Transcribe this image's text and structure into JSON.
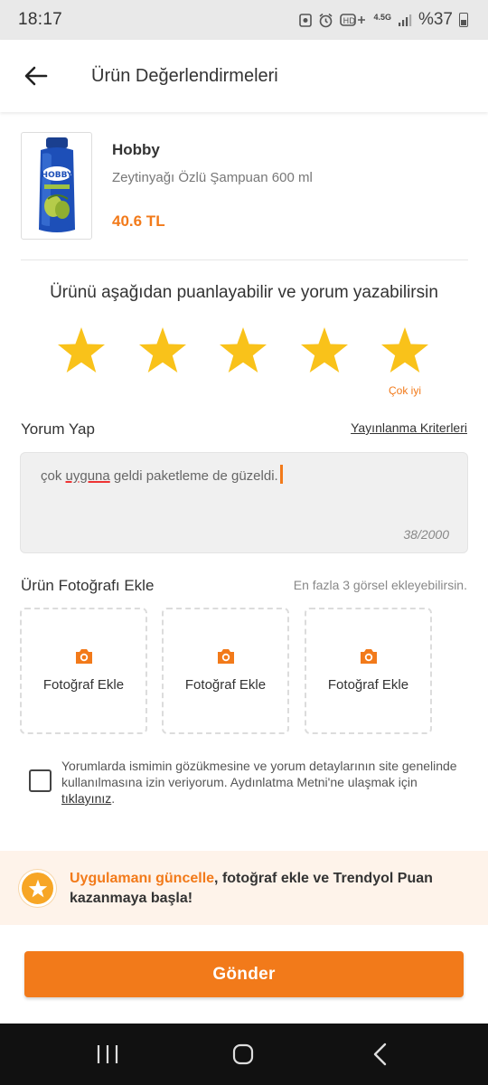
{
  "status_bar": {
    "time": "18:17",
    "network_label": "4.5G",
    "battery_text": "%37"
  },
  "header": {
    "title": "Ürün Değerlendirmeleri",
    "back_icon": "arrow-left-icon"
  },
  "product": {
    "brand": "Hobby",
    "name": "Zeytinyağı Özlü Şampuan 600 ml",
    "price": "40.6 TL",
    "image_brand_text": "HOBBY"
  },
  "rating": {
    "prompt": "Ürünü aşağıdan puanlayabilir ve yorum yazabilirsin",
    "value": 5,
    "max": 5,
    "label": "Çok iyi",
    "star_color": "#f9c21a"
  },
  "comment": {
    "title": "Yorum Yap",
    "criteria_link": "Yayınlanma Kriterleri",
    "text_before": "çok ",
    "text_misspelled": "uyguna",
    "text_after": " geldi paketleme de güzeldi.",
    "char_count": "38/2000"
  },
  "photos": {
    "title": "Ürün Fotoğrafı Ekle",
    "hint": "En fazla 3 görsel ekleyebilirsin.",
    "slots": [
      {
        "label": "Fotoğraf Ekle"
      },
      {
        "label": "Fotoğraf Ekle"
      },
      {
        "label": "Fotoğraf Ekle"
      }
    ]
  },
  "consent": {
    "text": "Yorumlarda ismimin gözükmesine ve yorum detaylarının site genelinde kullanılmasına izin veriyorum. Aydınlatma Metni'ne ulaşmak için ",
    "link": "tıklayınız",
    "suffix": ".",
    "checked": false
  },
  "promo": {
    "highlight": "Uygulamanı güncelle",
    "text": ", fotoğraf ekle ve Trendyol Puan kazanmaya başla!"
  },
  "submit": {
    "label": "Gönder"
  },
  "colors": {
    "brand_orange": "#f27a1a",
    "star": "#f9c21a",
    "promo_bg": "#fef3ea"
  }
}
